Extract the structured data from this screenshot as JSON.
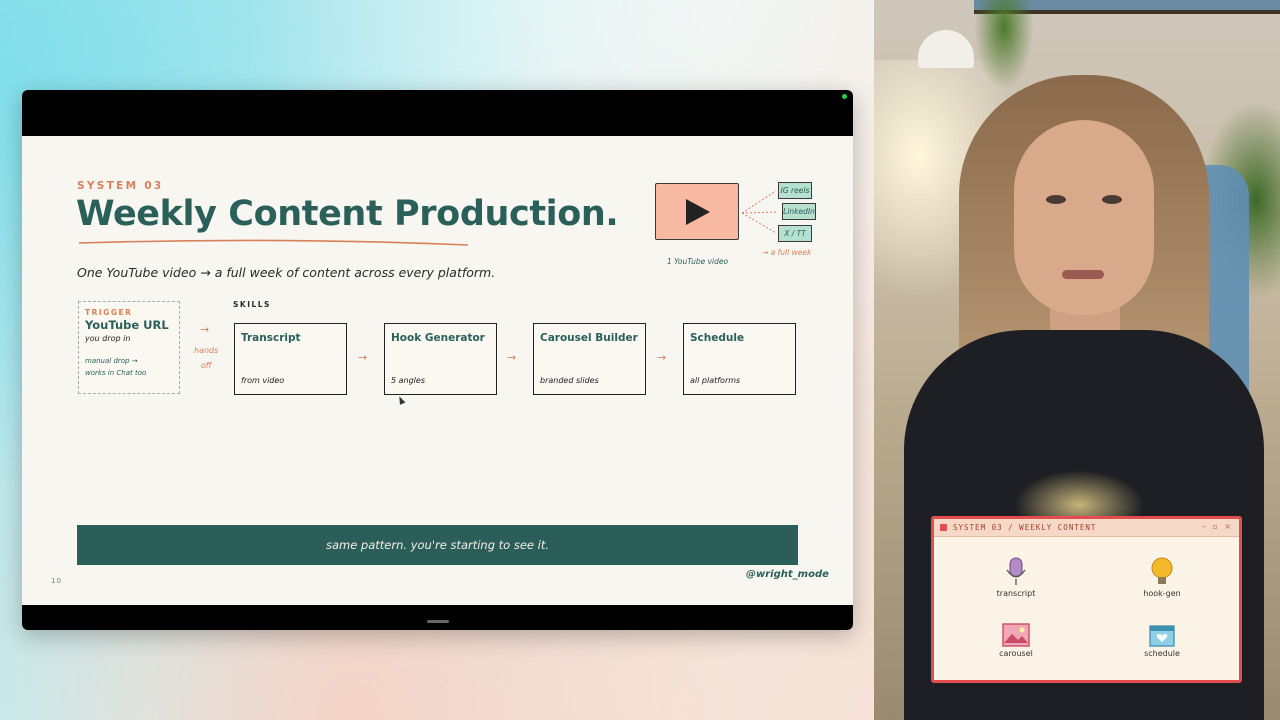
{
  "slide": {
    "eyebrow": "SYSTEM 03",
    "title": "Weekly Content Production.",
    "subtitle": "One YouTube video → a full week of content across every platform.",
    "visual": {
      "thumb_caption": "1 YouTube video",
      "platforms": [
        "IG reels",
        "LinkedIn",
        "X / TT"
      ],
      "week_caption": "→ a full week"
    },
    "trigger": {
      "label": "TRIGGER",
      "title": "YouTube URL",
      "sub": "you drop in",
      "note_line1": "manual drop →",
      "note_line2": "works in Chat too"
    },
    "hands_off_arrow": "→",
    "hands_off_line1": "hands",
    "hands_off_line2": "off",
    "skills_label": "SKILLS",
    "skills": [
      {
        "name": "Transcript",
        "desc": "from video"
      },
      {
        "name": "Hook Generator",
        "desc": "5 angles"
      },
      {
        "name": "Carousel Builder",
        "desc": "branded slides"
      },
      {
        "name": "Schedule",
        "desc": "all platforms"
      }
    ],
    "flow_arrow": "→",
    "banner": "same pattern. you're starting to see it.",
    "handle": "@wright_mode",
    "page_number": "10"
  },
  "popup": {
    "title": "SYSTEM 03 / WEEKLY CONTENT",
    "controls": "– ▫ ×",
    "tiles": [
      {
        "label": "transcript",
        "icon": "microphone-icon"
      },
      {
        "label": "hook-gen",
        "icon": "lightbulb-icon"
      },
      {
        "label": "carousel",
        "icon": "image-icon"
      },
      {
        "label": "schedule",
        "icon": "calendar-heart-icon"
      }
    ]
  },
  "colors": {
    "teal": "#2a5f5a",
    "accent_orange": "#d8805a",
    "popup_border": "#e24d4d"
  }
}
